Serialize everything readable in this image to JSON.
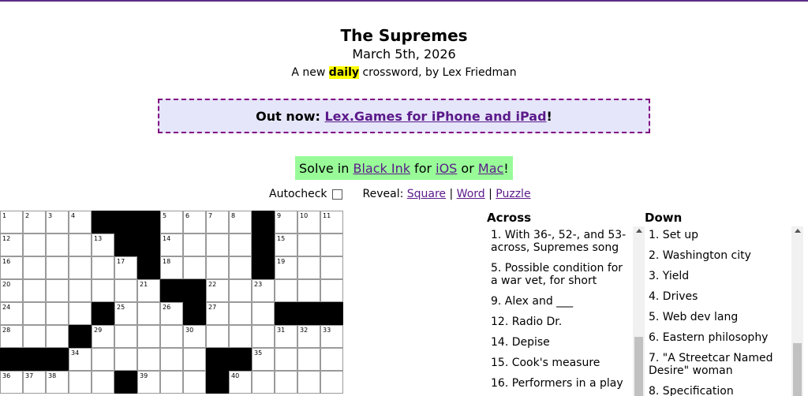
{
  "header": {
    "title": "The Supremes",
    "date": "March 5th, 2026",
    "byline_pre": "A new ",
    "byline_hl": "daily",
    "byline_post": " crossword, by Lex Friedman"
  },
  "promo": {
    "prefix": "Out now: ",
    "link": "Lex.Games for iPhone and iPad",
    "suffix": "!"
  },
  "solve": {
    "pre": "Solve in ",
    "app": "Black Ink",
    "mid1": " for ",
    "ios": "iOS",
    "mid2": " or ",
    "mac": "Mac",
    "end": "!"
  },
  "controls": {
    "autocheck": "Autocheck",
    "reveal": "Reveal:",
    "square": "Square",
    "word": "Word",
    "puzzle": "Puzzle",
    "sep": " | "
  },
  "grid": {
    "rows": [
      [
        "1",
        "2",
        "3",
        "4",
        "#",
        "#",
        "#",
        "5",
        "6",
        "7",
        "8",
        "#",
        "9",
        "10",
        "11"
      ],
      [
        "12",
        "",
        "",
        "",
        "13",
        "#",
        "#",
        "14",
        "",
        "",
        "",
        "#",
        "15",
        "",
        ""
      ],
      [
        "16",
        "",
        "",
        "",
        "",
        "17",
        "#",
        "18",
        "",
        "",
        "",
        "#",
        "19",
        "",
        ""
      ],
      [
        "20",
        "",
        "",
        "",
        "",
        "",
        "21",
        "#",
        "#",
        "22",
        "",
        "23",
        "",
        "",
        ""
      ],
      [
        "24",
        "",
        "",
        "",
        "#",
        "25",
        "",
        "26",
        "#",
        "27",
        "",
        "",
        "#",
        "#",
        "#"
      ],
      [
        "28",
        "",
        "",
        "#",
        "29",
        "",
        "",
        "",
        "30",
        "",
        "",
        "",
        "31",
        "32",
        "33"
      ],
      [
        "#",
        "#",
        "#",
        "34",
        "",
        "",
        "",
        "",
        "",
        "#",
        "#",
        "35",
        "",
        "",
        ""
      ],
      [
        "36",
        "37",
        "38",
        "",
        "",
        "#",
        "39",
        "",
        "",
        "#",
        "40",
        "",
        "",
        "",
        ""
      ]
    ]
  },
  "across": {
    "heading": "Across",
    "clues": [
      "1. With 36-, 52-, and 53-across, Supremes song",
      "5. Possible condition for a war vet, for short",
      "9. Alex and ___",
      "12. Radio Dr.",
      "14. Depise",
      "15. Cook's measure",
      "16. Performers in a play"
    ]
  },
  "down": {
    "heading": "Down",
    "clues": [
      "1. Set up",
      "2. Washington city",
      "3. Yield",
      "4. Drives",
      "5. Web dev lang",
      "6. Eastern philosophy",
      "7. \"A Streetcar Named Desire\" woman",
      "8. Specification"
    ]
  }
}
